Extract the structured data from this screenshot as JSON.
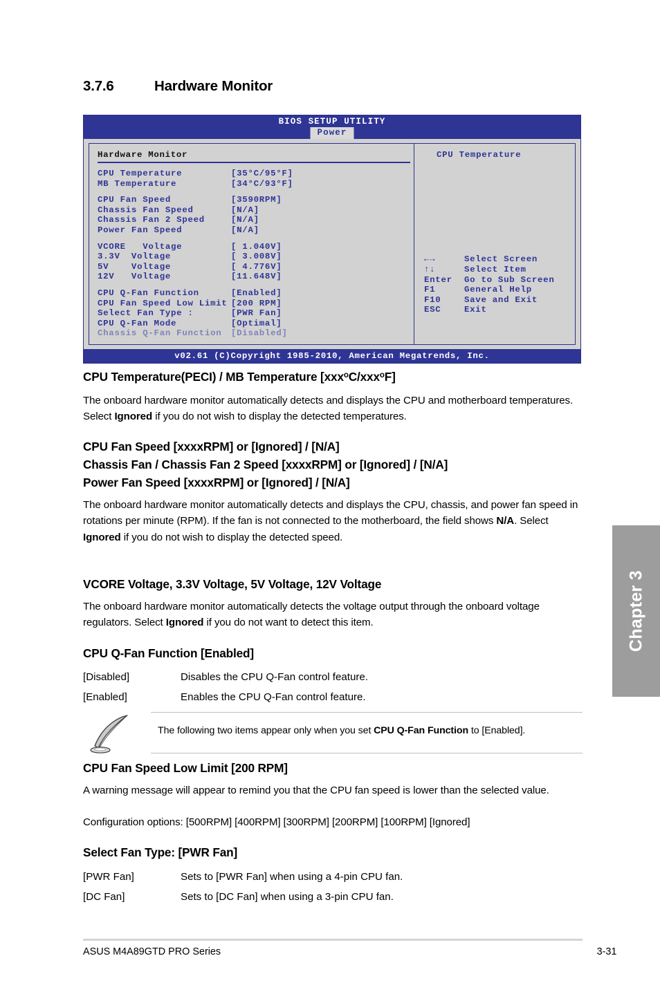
{
  "section": {
    "number": "3.7.6",
    "title": "Hardware Monitor"
  },
  "bios": {
    "title": "BIOS SETUP UTILITY",
    "tab": "Power",
    "panel_heading": "Hardware Monitor",
    "items": [
      {
        "label": "CPU Temperature",
        "value": "[35°C/95°F]",
        "dim": false
      },
      {
        "label": "MB Temperature",
        "value": "[34°C/93°F]",
        "dim": false
      },
      {
        "label": "CPU Fan Speed",
        "value": "[3590RPM]",
        "dim": false
      },
      {
        "label": "Chassis Fan Speed",
        "value": "[N/A]",
        "dim": false
      },
      {
        "label": "Chassis Fan 2 Speed",
        "value": "[N/A]",
        "dim": false
      },
      {
        "label": "Power Fan Speed",
        "value": "[N/A]",
        "dim": false
      },
      {
        "label": "VCORE   Voltage",
        "value": "[ 1.040V]",
        "dim": false
      },
      {
        "label": "3.3V  Voltage",
        "value": "[ 3.008V]",
        "dim": false
      },
      {
        "label": "5V    Voltage",
        "value": "[ 4.776V]",
        "dim": false
      },
      {
        "label": "12V   Voltage",
        "value": "[11.648V]",
        "dim": false
      },
      {
        "label": "CPU Q-Fan Function",
        "value": "[Enabled]",
        "dim": false
      },
      {
        "label": "CPU Fan Speed Low Limit",
        "value": "[200 RPM]",
        "dim": false
      },
      {
        "label": "Select Fan Type :",
        "value": "[PWR Fan]",
        "dim": false
      },
      {
        "label": "CPU Q-Fan Mode",
        "value": "[Optimal]",
        "dim": false
      },
      {
        "label": "Chassis Q-Fan Function",
        "value": "[Disabled]",
        "dim": true
      }
    ],
    "help_title": "CPU Temperature",
    "legend": [
      {
        "key": "←→",
        "action": "Select Screen"
      },
      {
        "key": "↑↓",
        "action": "Select Item"
      },
      {
        "key": "Enter",
        "action": "Go to Sub Screen"
      },
      {
        "key": "F1",
        "action": "General Help"
      },
      {
        "key": "F10",
        "action": "Save and Exit"
      },
      {
        "key": "ESC",
        "action": "Exit"
      }
    ],
    "footer": "v02.61 (C)Copyright 1985-2010, American Megatrends, Inc."
  },
  "content": {
    "h_temp_pre": "CPU Temperature(PECI) / MB Temperature [xxx",
    "h_temp_c": "C/xxx",
    "h_temp_f": "F]",
    "p_temp_1": "The onboard hardware monitor automatically detects and displays the CPU and motherboard temperatures. Select ",
    "p_temp_bold": "Ignored",
    "p_temp_2": " if you do not wish to display the detected temperatures.",
    "h_fan_1": "CPU Fan Speed [xxxxRPM] or [Ignored] / [N/A]",
    "h_fan_2": "Chassis Fan / Chassis Fan 2 Speed [xxxxRPM] or [Ignored] / [N/A]",
    "h_fan_3": "Power Fan Speed [xxxxRPM] or [Ignored] / [N/A]",
    "p_fan_1": "The onboard hardware monitor automatically detects and displays the CPU, chassis, and power fan speed in rotations per minute (RPM). If the fan is not connected to the motherboard, the field shows ",
    "p_fan_bold1": "N/A",
    "p_fan_2": ". Select ",
    "p_fan_bold2": "Ignored",
    "p_fan_3": " if you do not wish to display the detected speed.",
    "h_volt": "VCORE Voltage, 3.3V Voltage, 5V Voltage, 12V Voltage",
    "p_volt_1": "The onboard hardware monitor automatically detects the voltage output through the onboard voltage regulators. Select ",
    "p_volt_bold": "Ignored",
    "p_volt_2": " if you do not want to detect this item.",
    "h_qfan": "CPU Q-Fan Function [Enabled]",
    "qfan_options": [
      {
        "term": "[Disabled]",
        "desc": "Disables the CPU Q-Fan control feature."
      },
      {
        "term": "[Enabled]",
        "desc": "Enables the CPU Q-Fan control feature."
      }
    ],
    "note_1": "The following two items appear only when you set ",
    "note_bold": "CPU Q-Fan Function",
    "note_2": " to [Enabled].",
    "h_lowlimit": "CPU Fan Speed Low Limit [200 RPM]",
    "p_lowlimit": "A warning message will appear to remind you that the CPU fan speed is lower than the selected value.",
    "p_lowlimit_config": "Configuration options: [500RPM] [400RPM] [300RPM] [200RPM] [100RPM] [Ignored]",
    "h_fantype": "Select Fan Type: [PWR Fan]",
    "fantype_options": [
      {
        "term": "[PWR Fan]",
        "desc": "Sets to [PWR Fan] when using a 4-pin CPU fan."
      },
      {
        "term": "[DC Fan]",
        "desc": "Sets to [DC Fan] when using a 3-pin CPU fan."
      }
    ]
  },
  "chapter_tab": "Chapter 3",
  "footer": {
    "left": "ASUS M4A89GTD PRO Series",
    "page": "3-31"
  }
}
